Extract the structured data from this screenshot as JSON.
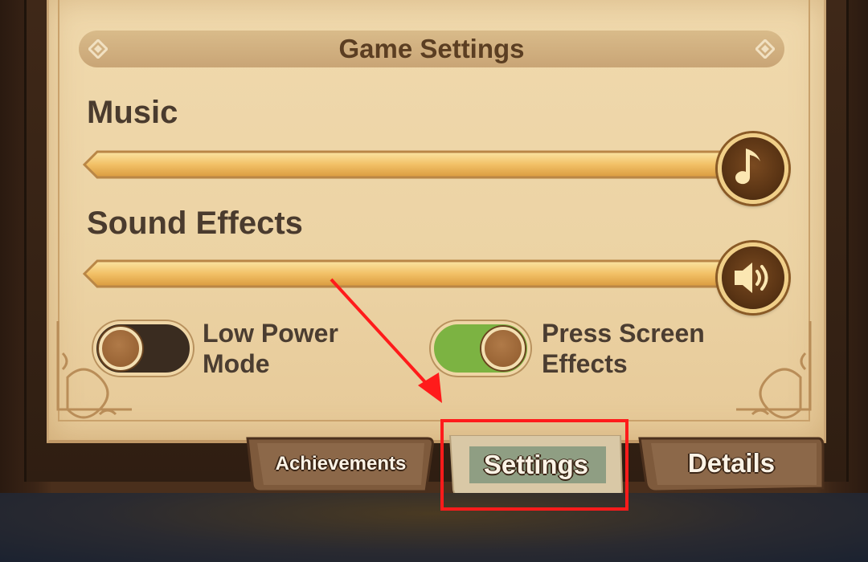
{
  "banner": {
    "title": "Game Settings"
  },
  "music": {
    "label": "Music",
    "level": 1.0,
    "icon": "music-note-icon"
  },
  "sound_effects": {
    "label": "Sound Effects",
    "level": 1.0,
    "icon": "speaker-icon"
  },
  "toggles": {
    "low_power": {
      "line1": "Low Power",
      "line2": "Mode",
      "on": false
    },
    "press_screen": {
      "line1": "Press Screen",
      "line2": "Effects",
      "on": true
    }
  },
  "tabs": {
    "achievements": "Achievements",
    "settings": "Settings",
    "details": "Details",
    "active": "settings"
  },
  "colors": {
    "toggle_on": "#7cb342",
    "toggle_off": "#3a2c20",
    "annotation": "#ff1b1b"
  }
}
